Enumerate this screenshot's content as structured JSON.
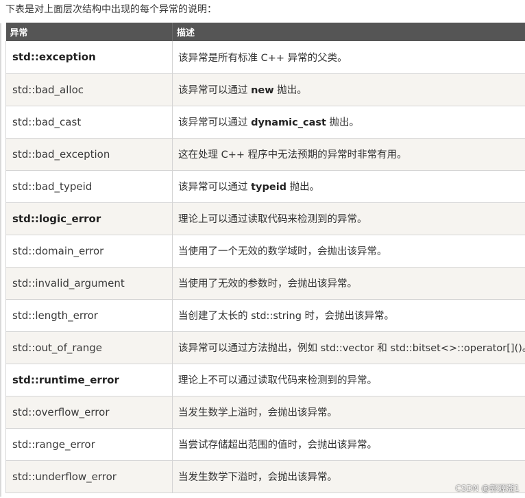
{
  "intro": "下表是对上面层次结构中出现的每个异常的说明：",
  "table": {
    "headers": [
      "异常",
      "描述"
    ],
    "rows": [
      {
        "name": "std::exception",
        "bold": true,
        "desc_pre": "该异常是所有标准 C++ 异常的父类。",
        "desc_kw": "",
        "desc_post": ""
      },
      {
        "name": "std::bad_alloc",
        "bold": false,
        "desc_pre": "该异常可以通过 ",
        "desc_kw": "new",
        "desc_post": " 抛出。"
      },
      {
        "name": "std::bad_cast",
        "bold": false,
        "desc_pre": "该异常可以通过 ",
        "desc_kw": "dynamic_cast",
        "desc_post": " 抛出。"
      },
      {
        "name": "std::bad_exception",
        "bold": false,
        "desc_pre": "这在处理 C++ 程序中无法预期的异常时非常有用。",
        "desc_kw": "",
        "desc_post": ""
      },
      {
        "name": "std::bad_typeid",
        "bold": false,
        "desc_pre": "该异常可以通过 ",
        "desc_kw": "typeid",
        "desc_post": " 抛出。"
      },
      {
        "name": "std::logic_error",
        "bold": true,
        "desc_pre": "理论上可以通过读取代码来检测到的异常。",
        "desc_kw": "",
        "desc_post": ""
      },
      {
        "name": "std::domain_error",
        "bold": false,
        "desc_pre": "当使用了一个无效的数学域时，会抛出该异常。",
        "desc_kw": "",
        "desc_post": ""
      },
      {
        "name": "std::invalid_argument",
        "bold": false,
        "desc_pre": "当使用了无效的参数时，会抛出该异常。",
        "desc_kw": "",
        "desc_post": ""
      },
      {
        "name": "std::length_error",
        "bold": false,
        "desc_pre": "当创建了太长的 std::string 时，会抛出该异常。",
        "desc_kw": "",
        "desc_post": ""
      },
      {
        "name": "std::out_of_range",
        "bold": false,
        "desc_pre": "该异常可以通过方法抛出，例如 std::vector 和 std::bitset<>::operator[]()。",
        "desc_kw": "",
        "desc_post": ""
      },
      {
        "name": "std::runtime_error",
        "bold": true,
        "desc_pre": "理论上不可以通过读取代码来检测到的异常。",
        "desc_kw": "",
        "desc_post": ""
      },
      {
        "name": "std::overflow_error",
        "bold": false,
        "desc_pre": "当发生数学上溢时，会抛出该异常。",
        "desc_kw": "",
        "desc_post": ""
      },
      {
        "name": "std::range_error",
        "bold": false,
        "desc_pre": "当尝试存储超出范围的值时，会抛出该异常。",
        "desc_kw": "",
        "desc_post": ""
      },
      {
        "name": "std::underflow_error",
        "bold": false,
        "desc_pre": "当发生数学下溢时，会抛出该异常。",
        "desc_kw": "",
        "desc_post": ""
      }
    ]
  },
  "watermark": "CSDN @郭源潮1"
}
